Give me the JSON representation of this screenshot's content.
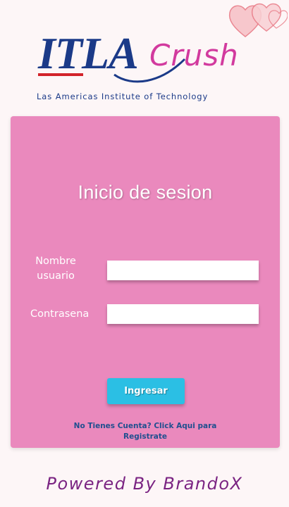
{
  "logo": {
    "main": "ITLA",
    "accent": "Crush",
    "subtitle": "Las Americas Institute of Technology"
  },
  "form": {
    "title": "Inicio de sesion",
    "username_label_line1": "Nombre",
    "username_label_line2": "usuario",
    "username_value": "",
    "password_label": "Contrasena",
    "password_value": "",
    "submit_label": "Ingresar",
    "register_link": "No Tienes Cuenta? Click Aqui para Registrate"
  },
  "footer": {
    "text": "Powered By BrandoX"
  },
  "colors": {
    "page_bg": "#fdf6f7",
    "card_bg": "#ea89bd",
    "button_bg": "#2bbfe4",
    "logo_blue": "#1b3a88",
    "logo_red": "#d2232a",
    "crush_pink": "#d23a9e",
    "link_blue": "#1f4f8f",
    "footer_purple": "#7a2382",
    "hearts": "#e87a86"
  },
  "icons": {
    "decoration": "hearts-icon"
  }
}
